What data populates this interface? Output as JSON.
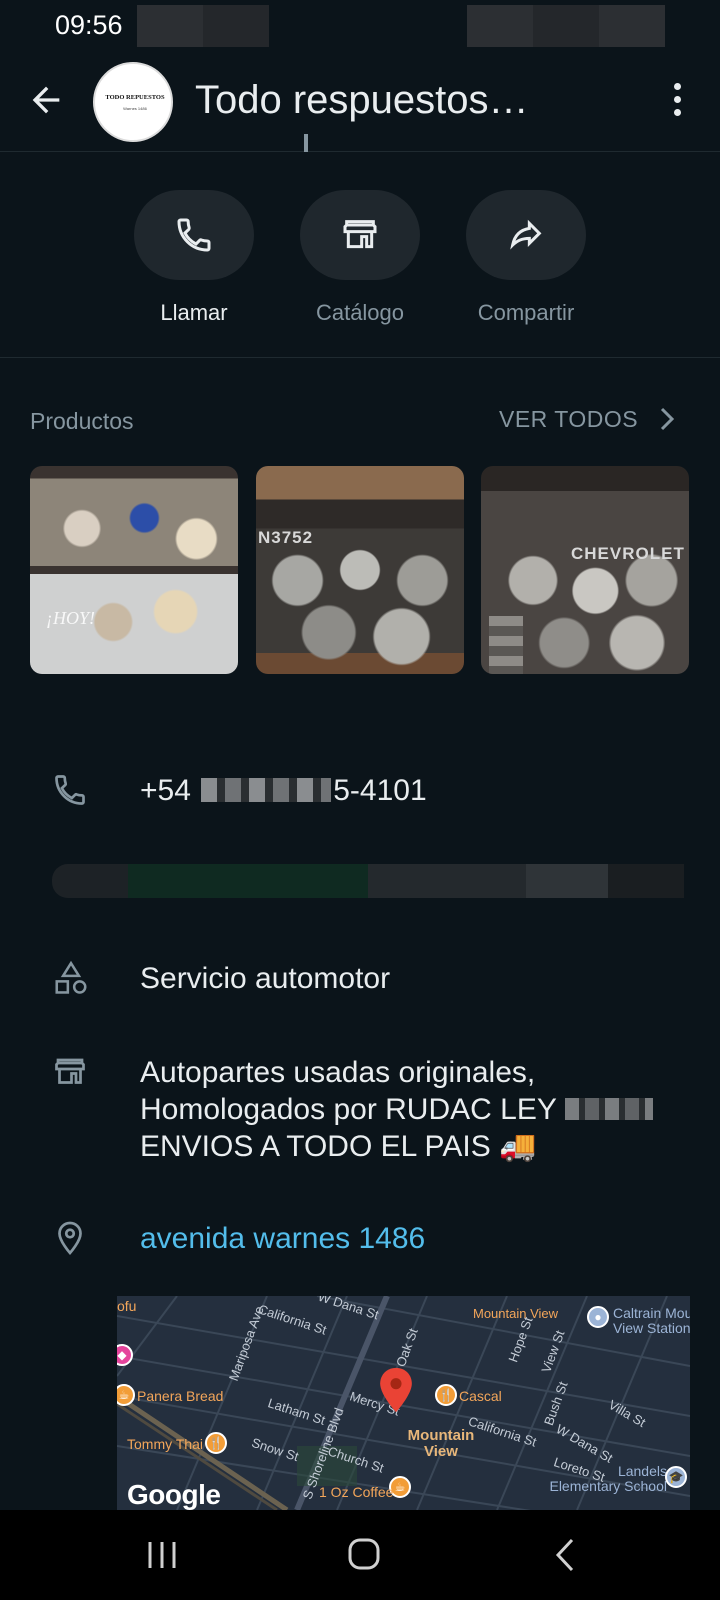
{
  "status_bar": {
    "time": "09:56"
  },
  "header": {
    "title": "Todo respuestos…",
    "avatar_text": "TODO REPUESTOS",
    "avatar_subtext": "Warnes 1486"
  },
  "actions": [
    {
      "label": "Llamar",
      "icon": "phone-icon"
    },
    {
      "label": "Catálogo",
      "icon": "store-icon"
    },
    {
      "label": "Compartir",
      "icon": "share-arrow-icon"
    }
  ],
  "products": {
    "title": "Productos",
    "see_all": "VER TODOS",
    "items": [
      {
        "overlay_text": "¡HOY!"
      },
      {
        "overlay_text": "N3752"
      },
      {
        "overlay_text": "CHEVROLET"
      }
    ]
  },
  "info": {
    "phone_prefix": "+54",
    "phone_suffix": "5-4101",
    "category": "Servicio automotor",
    "description_line1": "Autopartes usadas originales,",
    "description_line2": "Homologados por RUDAC LEY",
    "description_line3": "ENVIOS A TODO EL PAIS 🚚",
    "address": "avenida warnes 1486"
  },
  "map": {
    "streets": [
      "California St",
      "W Dana St",
      "Oak St",
      "Mariposa Ave",
      "Latham St",
      "Mercy St",
      "S Shoreline Blvd",
      "Church St",
      "Snow St",
      "Hope St",
      "View St",
      "Bush St",
      "Villa St",
      "W Dana St",
      "Loreto St",
      "California St"
    ],
    "pois": [
      "Panera Bread",
      "Tommy Thai",
      "Cascal",
      "1 Oz Coffee",
      "Mountain View",
      "Caltrain Mou View Station",
      "Landels Elementary School",
      "ofu"
    ],
    "city": "Mountain View",
    "attribution": "Google"
  },
  "colors": {
    "background": "#0b141a",
    "link": "#53bdeb",
    "secondary_text": "#8696a0"
  }
}
